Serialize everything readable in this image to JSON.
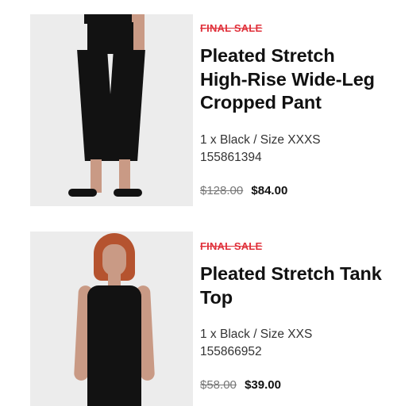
{
  "items": [
    {
      "badge": "FINAL SALE",
      "title": "Pleated Stretch High-Rise Wide-Leg Cropped Pant",
      "variant": "1 x Black / Size XXXS",
      "sku": "155861394",
      "original_price": "$128.00",
      "sale_price": "$84.00"
    },
    {
      "badge": "FINAL SALE",
      "title": "Pleated Stretch Tank Top",
      "variant": "1 x Black / Size XXS",
      "sku": "155866952",
      "original_price": "$58.00",
      "sale_price": "$39.00"
    }
  ],
  "colors": {
    "badge": "#e0313b",
    "image_background": "#ececec",
    "product_color": "#121212"
  }
}
